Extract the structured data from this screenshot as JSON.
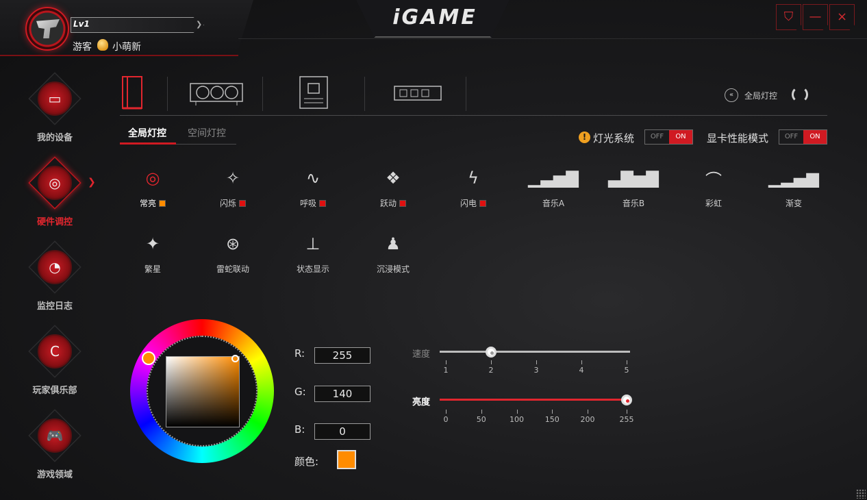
{
  "app": {
    "logo_text": "iGAME",
    "window_buttons": [
      {
        "name": "skin-button",
        "icon": "shirt-icon",
        "glyph": "⛉"
      },
      {
        "name": "minimize-button",
        "icon": "minimize-icon",
        "glyph": "—"
      },
      {
        "name": "close-button",
        "icon": "close-icon",
        "glyph": "×"
      }
    ]
  },
  "user": {
    "level": "Lv1",
    "role": "游客",
    "nickname": "小萌新"
  },
  "sidebar": {
    "items": [
      {
        "label": "我的设备",
        "icon": "monitor-icon",
        "glyph": "▭",
        "active": false
      },
      {
        "label": "硬件调控",
        "icon": "dpad-icon",
        "glyph": "◎",
        "active": true
      },
      {
        "label": "监控日志",
        "icon": "gauge-icon",
        "glyph": "◔",
        "active": false
      },
      {
        "label": "玩家俱乐部",
        "icon": "colorful-logo-icon",
        "glyph": "C",
        "active": false
      },
      {
        "label": "游戏领域",
        "icon": "gamepad-icon",
        "glyph": "🎮",
        "active": false
      }
    ]
  },
  "devices": [
    {
      "name": "pc-case",
      "icon": "pc-case-icon",
      "active": true
    },
    {
      "name": "graphics-card",
      "icon": "graphics-card-icon",
      "active": false
    },
    {
      "name": "motherboard",
      "icon": "motherboard-icon",
      "active": false
    },
    {
      "name": "memory",
      "icon": "memory-icon",
      "active": false
    }
  ],
  "global_control": {
    "label": "全局灯控"
  },
  "tabs": [
    {
      "label": "全局灯控",
      "active": true
    },
    {
      "label": "空间灯控",
      "active": false
    }
  ],
  "switches": {
    "light_system": {
      "label": "灯光系统",
      "off": "OFF",
      "on": "ON",
      "state": "ON"
    },
    "gpu_performance": {
      "label": "显卡性能模式",
      "off": "OFF",
      "on": "ON",
      "state": "ON"
    }
  },
  "effects": [
    {
      "label": "常亮",
      "icon": "target-icon",
      "glyph": "◎",
      "swatch": "#ff8c00",
      "active": true
    },
    {
      "label": "闪烁",
      "icon": "sparkle-icon",
      "glyph": "✧",
      "swatch": "#e01010",
      "active": false
    },
    {
      "label": "呼吸",
      "icon": "pulse-icon",
      "glyph": "∿",
      "swatch": "#e01010",
      "active": false
    },
    {
      "label": "跃动",
      "icon": "jump-icon",
      "glyph": "❖",
      "swatch": "#e01010",
      "active": false
    },
    {
      "label": "闪电",
      "icon": "lightning-icon",
      "glyph": "ϟ",
      "swatch": "#e01010",
      "active": false
    },
    {
      "label": "音乐A",
      "icon": "bars-a-icon",
      "glyph": "▁▃▅▇",
      "swatch": null,
      "active": false
    },
    {
      "label": "音乐B",
      "icon": "bars-b-icon",
      "glyph": "▃▇▅▇",
      "swatch": null,
      "active": false
    },
    {
      "label": "彩虹",
      "icon": "rainbow-icon",
      "glyph": "⌒",
      "swatch": null,
      "active": false
    },
    {
      "label": "渐变",
      "icon": "gradient-bars-icon",
      "glyph": "▁▂▄▆",
      "swatch": null,
      "active": false
    },
    {
      "label": "繁星",
      "icon": "stars-icon",
      "glyph": "✦",
      "swatch": null,
      "active": false
    },
    {
      "label": "雷蛇联动",
      "icon": "razer-sync-icon",
      "glyph": "⊛",
      "swatch": null,
      "active": false
    },
    {
      "label": "状态显示",
      "icon": "status-icon",
      "glyph": "⊥",
      "swatch": null,
      "active": false
    },
    {
      "label": "沉浸模式",
      "icon": "immersive-icon",
      "glyph": "♟",
      "swatch": null,
      "active": false
    }
  ],
  "color": {
    "r_label": "R:",
    "r": "255",
    "g_label": "G:",
    "g": "140",
    "b_label": "B:",
    "b": "0",
    "swatch_label": "颜色:",
    "hex": "#ff8c00"
  },
  "speed": {
    "label": "速度",
    "ticks": [
      "1",
      "2",
      "3",
      "4",
      "5"
    ],
    "value": 2,
    "min": 1,
    "max": 5
  },
  "brightness": {
    "label": "亮度",
    "ticks": [
      "0",
      "50",
      "100",
      "150",
      "200",
      "255"
    ],
    "value": 255,
    "min": 0,
    "max": 255
  }
}
